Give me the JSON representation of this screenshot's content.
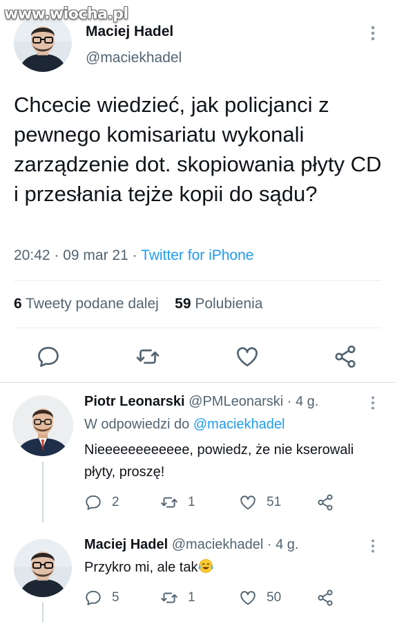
{
  "watermark": "www.wiocha.pl",
  "tweet": {
    "author_name": "Maciej Hadel",
    "author_handle": "@maciekhadel",
    "text": "Chcecie wiedzieć, jak policjanci z pewnego komisariatu wykonali zarządzenie dot. skopiowania płyty CD i przesłania tejże kopii do sądu?",
    "time": "20:42 · 09 mar 21 · ",
    "source": "Twitter for iPhone",
    "retweets_count": "6",
    "retweets_label": " Tweety podane dalej",
    "likes_count": "59",
    "likes_label": " Polubienia"
  },
  "replies": [
    {
      "name": "Piotr Leonarski",
      "handle": " @PMLeonarski · 4 g.",
      "reply_to_label": "W odpowiedzi do ",
      "reply_to_handle": "@maciekhadel",
      "text": "Nieeeeeeeeeeee, powiedz, że nie kserowali płyty, proszę!",
      "replies": "2",
      "retweets": "1",
      "likes": "51"
    },
    {
      "name": "Maciej Hadel",
      "handle": " @maciekhadel · 4 g.",
      "text": "Przykro mi, ale tak",
      "emoji": "face-with-tears-of-joy",
      "replies": "5",
      "retweets": "1",
      "likes": "50"
    }
  ],
  "colors": {
    "accent": "#1d9bf0",
    "secondary_text": "#536471",
    "primary_text": "#0f1419",
    "divider": "#e6ecf0"
  }
}
